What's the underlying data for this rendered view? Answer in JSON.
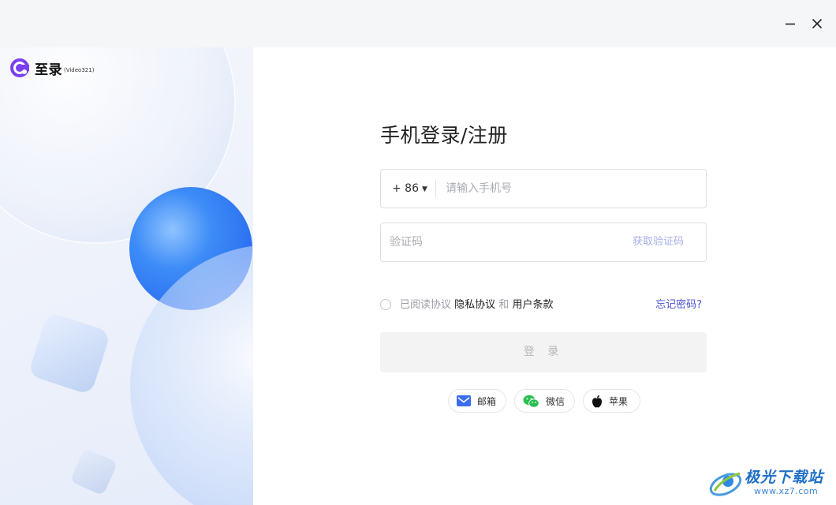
{
  "window": {
    "minimize_icon": "minimize-icon",
    "close_icon": "close-icon"
  },
  "brand": {
    "name": "至录",
    "sub": "(Video321)",
    "accent": "#7b3ff2"
  },
  "login": {
    "title": "手机登录/注册",
    "country_code": "+ 86",
    "phone_placeholder": "请输入手机号",
    "code_placeholder": "验证码",
    "get_code": "获取验证码",
    "agree_prefix": "已阅读协议",
    "privacy": "隐私协议",
    "and": "和",
    "terms": "用户条款",
    "forgot": "忘记密码?",
    "submit": "登 录"
  },
  "social": [
    {
      "label": "邮箱",
      "icon": "mail-icon",
      "color": "#3b6df0"
    },
    {
      "label": "微信",
      "icon": "wechat-icon",
      "color": "#2ac04f"
    },
    {
      "label": "苹果",
      "icon": "apple-icon",
      "color": "#111111"
    }
  ],
  "watermark": {
    "name": "极光下载站",
    "url": "www.xz7.com"
  }
}
